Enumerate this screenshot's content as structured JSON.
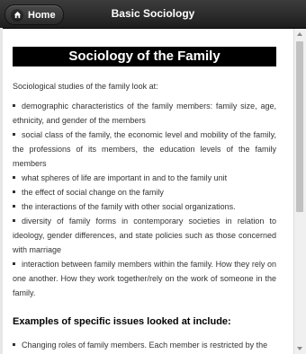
{
  "header": {
    "home_label": "Home",
    "home_icon": "home-icon",
    "title": "Basic Sociology"
  },
  "page": {
    "section_title": "Sociology of the Family",
    "intro": "Sociological studies of the family look at:",
    "items": [
      "demographic characteristics of the family members: family size, age, ethnicity, and gender of the members",
      "social class of the family, the economic level and mobility of the family, the professions of its members, the education levels of the family members",
      "what spheres of life are important in and to the family unit",
      "the effect of social change on the family",
      "the interactions of the family with other social organizations.",
      "diversity of family forms in contemporary societies in relation to ideology, gender differences, and state policies such as those concerned with marriage",
      "interaction between family members within the family. How they rely on one another. How they work together/rely on the work of someone in the family."
    ],
    "examples_heading": "Examples of specific issues looked at include:",
    "examples": [
      "Changing roles of family members. Each member is restricted by the"
    ]
  }
}
